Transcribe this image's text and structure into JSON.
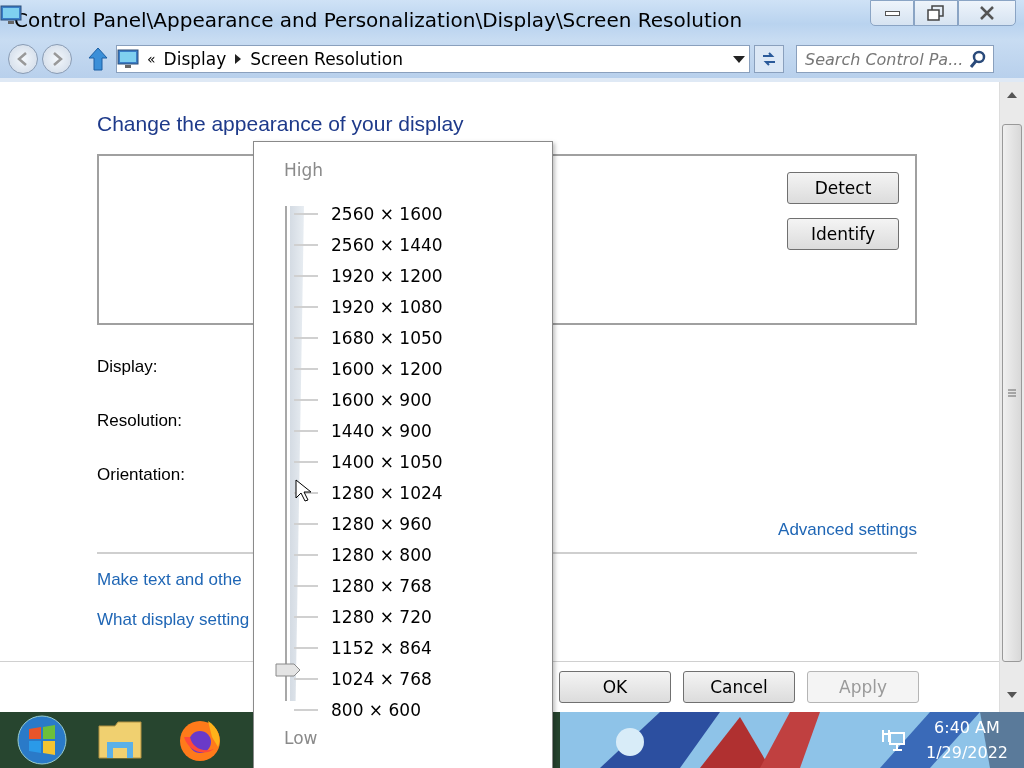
{
  "window": {
    "title": "Control Panel\\Appearance and Personalization\\Display\\Screen Resolution"
  },
  "address_bar": {
    "overflow": "«",
    "breadcrumbs": [
      "Display",
      "Screen Resolution"
    ],
    "search": {
      "placeholder": "Search Control Pa..."
    }
  },
  "content": {
    "heading": "Change the appearance of your display",
    "monitor_buttons": [
      {
        "label": "Detect"
      },
      {
        "label": "Identify"
      }
    ],
    "settings": [
      {
        "label": "Display:"
      },
      {
        "label": "Resolution:"
      },
      {
        "label": "Orientation:"
      }
    ],
    "advanced_link": "Advanced settings",
    "links": [
      "Make text and othe",
      "What display setting"
    ],
    "buttons": [
      {
        "label": "OK",
        "disabled": false
      },
      {
        "label": "Cancel",
        "disabled": false
      },
      {
        "label": "Apply",
        "disabled": true
      }
    ]
  },
  "resolution_popup": {
    "high": "High",
    "low": "Low",
    "level": 0.0625,
    "options": [
      "2560 × 1600",
      "2560 × 1440",
      "1920 × 1200",
      "1920 × 1080",
      "1680 × 1050",
      "1600 × 1200",
      "1600 × 900",
      "1440 × 900",
      "1400 × 1050",
      "1280 × 1024",
      "1280 × 960",
      "1280 × 800",
      "1280 × 768",
      "1280 × 720",
      "1152 × 864",
      "1024 × 768",
      "800 × 600"
    ]
  },
  "taskbar": {
    "time": "6:40 AM",
    "date": "1/29/2022"
  }
}
